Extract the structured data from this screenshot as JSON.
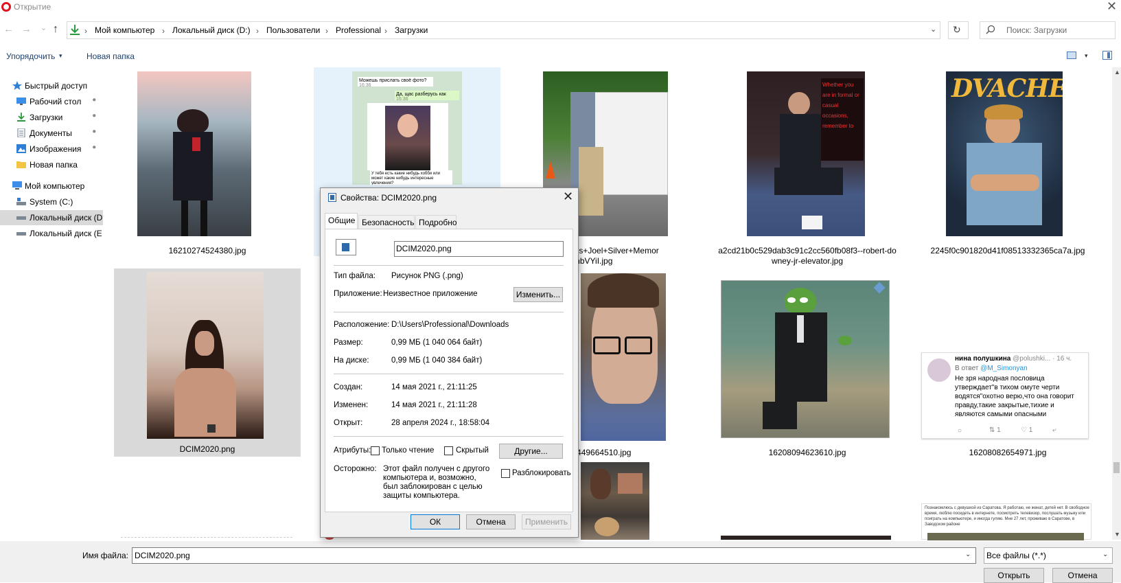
{
  "window": {
    "title": "Открытие",
    "close": "✕"
  },
  "nav": {
    "back": "←",
    "forward": "→",
    "recent": "⌄",
    "up": "↑",
    "breadcrumb": [
      "Мой компьютер",
      "Локальный диск (D:)",
      "Пользователи",
      "Professional",
      "Загрузки"
    ],
    "separator": "›",
    "dropdown": "⌄",
    "refresh": "↻",
    "search_placeholder": "Поиск: Загрузки"
  },
  "toolbar": {
    "organize": "Упорядочить",
    "organize_caret": "▾",
    "new_folder": "Новая папка",
    "view_caret": "▾"
  },
  "sidebar": {
    "items": [
      {
        "label": "Быстрый доступ",
        "icon": "star-icon"
      },
      {
        "label": "Рабочий стол",
        "icon": "desktop-icon",
        "pinned": true
      },
      {
        "label": "Загрузки",
        "icon": "download-icon",
        "pinned": true
      },
      {
        "label": "Документы",
        "icon": "document-icon",
        "pinned": true
      },
      {
        "label": "Изображения",
        "icon": "pictures-icon",
        "pinned": true
      },
      {
        "label": "Новая папка",
        "icon": "folder-icon"
      },
      {
        "label": "Мой компьютер",
        "icon": "computer-icon"
      },
      {
        "label": "System (C:)",
        "icon": "drive-icon"
      },
      {
        "label": "Локальный диск (D",
        "icon": "drive-icon",
        "selected": true
      },
      {
        "label": "Локальный диск (E",
        "icon": "drive-icon"
      }
    ],
    "pin_glyph": "📌"
  },
  "files": [
    {
      "name": "16210274524380.jpg"
    },
    {
      "name": ""
    },
    {
      "name_line1": "-Jr+Celebs+Joel+Silver+Memor",
      "name_line2": "-LVB1hKnbVYiI.jpg"
    },
    {
      "name_line1": "a2cd21b0c529dab3c91c2cc560fb08f3--robert-do",
      "name_line2": "wney-jr-elevator.jpg"
    },
    {
      "name": "2245f0c901820d41f08513332365ca7a.jpg"
    },
    {
      "name": "DCIM2020.png"
    },
    {
      "name": "209449664510.jpg"
    },
    {
      "name": "16208094623610.jpg"
    },
    {
      "name": "16208082654971.jpg"
    }
  ],
  "thumb_text": {
    "chat_msg1": "Можешь прислать своё фото?",
    "chat_msg1_time": "16:36",
    "chat_msg2": "Да, щас разберусь как",
    "chat_msg2_time": "16:36",
    "chat_msg3": "У тебя есть какие нибудь хобби или может какие нибудь интересные увлечения?",
    "poster_title": "DVACHER",
    "quote_text": "Whether you are in formal or casual occasions, remember to",
    "tweet_name": "нина полушкина",
    "tweet_handle": "@polushki...",
    "tweet_time": "· 16 ч.",
    "tweet_reply": "В ответ",
    "tweet_reply_to": "@M_Simonyan",
    "tweet_body": "Не зря народная пословица утверждает\"в тихом омуте черти водятся\"охотно верю,что она говорит правду,такие закрытые,тихие и являются самыми опасными",
    "tweet_retweets": "1",
    "tweet_likes": "1",
    "post_text": "Познакомлюсь с девушкой из Саратова. Я работаю, не женат, детей нет. В свободное время, люблю посидеть в интернете, посмотреть телевизор, послушать музыку или поиграть на компьютере, и иногда гуляю. Мне 27 лет, проживаю в Саратове, в Заводском районе"
  },
  "bottom": {
    "filename_label": "Имя файла:",
    "filename_value": "DCIM2020.png",
    "dd": "⌄",
    "type_value": "Все файлы (*.*)",
    "open_btn": "Открыть",
    "cancel_btn": "Отмена"
  },
  "scroll": {
    "up": "▲",
    "down": "▼"
  },
  "dialog": {
    "title": "Свойства: DCIM2020.png",
    "close": "✕",
    "tabs": [
      "Общие",
      "Безопасность",
      "Подробно"
    ],
    "filename": "DCIM2020.png",
    "type_label": "Тип файла:",
    "type_value": "Рисунок PNG (.png)",
    "app_label": "Приложение:",
    "app_value": "Неизвестное приложение",
    "change_btn": "Изменить...",
    "location_label": "Расположение:",
    "location_value": "D:\\Users\\Professional\\Downloads",
    "size_label": "Размер:",
    "size_value": "0,99 МБ (1 040 064 байт)",
    "disk_label": "На диске:",
    "disk_value": "0,99 МБ (1 040 384 байт)",
    "created_label": "Создан:",
    "created_value": "14 мая 2021 г., 21:11:25",
    "modified_label": "Изменен:",
    "modified_value": "14 мая 2021 г., 21:11:28",
    "opened_label": "Открыт:",
    "opened_value": "28 апреля 2024 г., 18:58:04",
    "attributes_label": "Атрибуты:",
    "readonly_label": "Только чтение",
    "hidden_label": "Скрытый",
    "other_btn": "Другие...",
    "caution_label": "Осторожно:",
    "caution_text": "Этот файл получен с другого компьютера и, возможно, был заблокирован с целью защиты компьютера.",
    "unblock_label": "Разблокировать",
    "ok_btn": "ОК",
    "cancel_btn": "Отмена",
    "apply_btn": "Применить"
  }
}
